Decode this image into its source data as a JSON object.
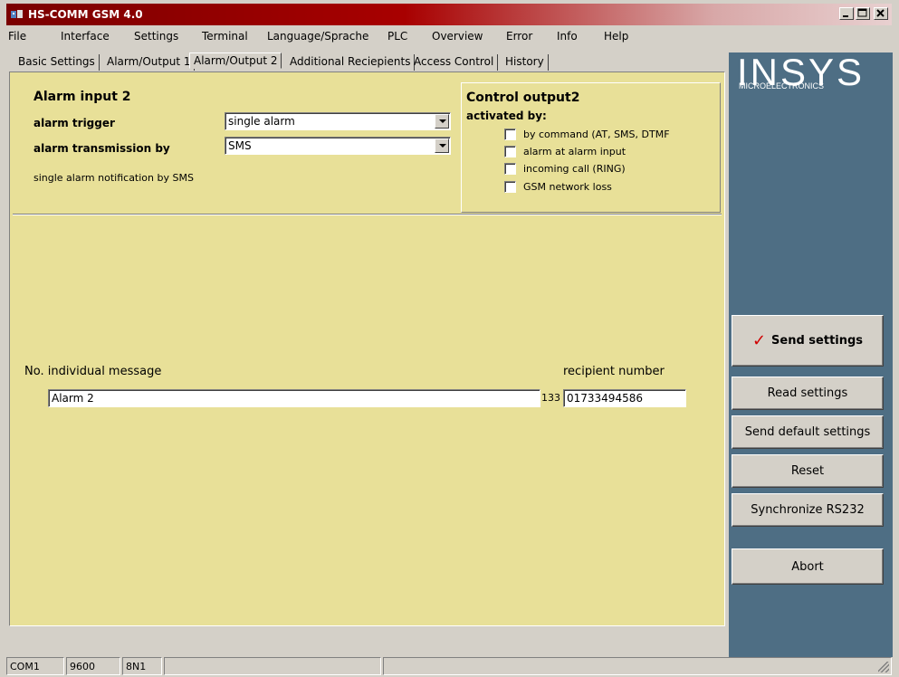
{
  "window": {
    "title": "HS-COMM GSM 4.0"
  },
  "menu": [
    "File",
    "Interface",
    "Settings",
    "Terminal",
    "Language/Sprache",
    "PLC",
    "Overview",
    "Error",
    "Info",
    "Help"
  ],
  "tabs": [
    "Basic Settings",
    "Alarm/Output 1",
    "Alarm/Output 2",
    "Additional Reciepients",
    "Access Control",
    "History"
  ],
  "active_tab": "Alarm/Output 2",
  "alarm_input": {
    "heading": "Alarm input 2",
    "trigger_label": "alarm trigger",
    "trigger_value": "single alarm",
    "transmission_label": "alarm transmission by",
    "transmission_value": "SMS",
    "note": "single alarm notification by SMS"
  },
  "control_output": {
    "heading": "Control output2",
    "activated_by": "activated by:",
    "options": [
      {
        "label": "by command (AT, SMS, DTMF",
        "checked": false
      },
      {
        "label": "alarm at alarm input",
        "checked": false
      },
      {
        "label": "incoming call (RING)",
        "checked": false
      },
      {
        "label": "GSM network loss",
        "checked": false
      }
    ]
  },
  "messages": {
    "col_no_msg": "No. individual message",
    "col_recipient": "recipient number",
    "message_value": "Alarm 2",
    "char_count": "133",
    "recipient_value": "01733494586"
  },
  "sidebar": {
    "logo": "INSYS",
    "logo_sub": "MICROELECTRONICS",
    "send_settings": "Send settings",
    "read_settings": "Read settings",
    "send_default": "Send default settings",
    "reset": "Reset",
    "sync": "Synchronize RS232",
    "abort": "Abort"
  },
  "status": {
    "port": "COM1",
    "baud": "9600",
    "format": "8N1"
  },
  "colors": {
    "panel": "#e8e098",
    "sidebar": "#4e6e84",
    "titlebar": "#a80000"
  }
}
